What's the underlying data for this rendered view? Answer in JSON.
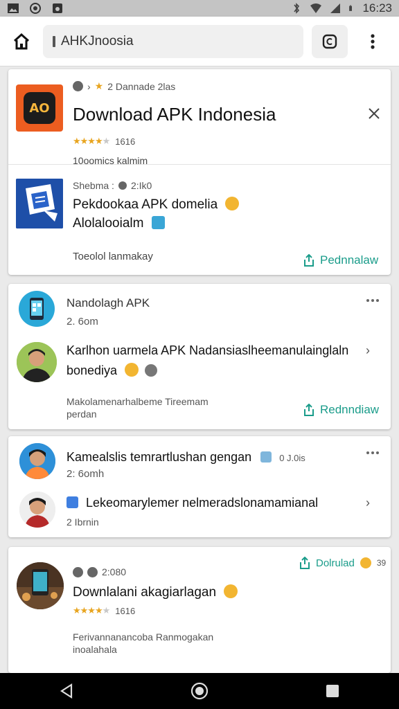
{
  "status_bar": {
    "time": "16:23"
  },
  "browser": {
    "url": "AHKJnoosia"
  },
  "card1": {
    "meta": "2 Dannade 2las",
    "title": "Download APK Indonesia",
    "rating_count": "1616",
    "subtitle": "10oomics kalmim",
    "app_icon_text": "AO",
    "post_meta": "Shebma : ",
    "post_time": "2:Ik0",
    "line1": "Pekdookaa APK domelia",
    "line2": "Alolalooialm",
    "footer": "Toeolol lanmakay",
    "action": "Pednnalaw"
  },
  "card2": {
    "title": "Nandolagh APK",
    "size": "2. 6om",
    "comment": "Karlhon uarmela APK Nadansiaslheemanulainglaln",
    "comment2": "bonediya",
    "footer1": "Makolamenarhalbeme Tireemam",
    "footer2": "perdan",
    "action": "Rednndiaw"
  },
  "card3": {
    "title": "Kamealslis temrartlushan gengan",
    "suffix": "0 J.0is",
    "size": "2: 6omh",
    "comment": "Lekeomarylemer nelmeradslonamamianal",
    "sub": "2 Ibrnin"
  },
  "card4": {
    "action": "Dolrulad",
    "badge": "39",
    "meta_time": "2:080",
    "title": "Downlalani akagiarlagan",
    "rating_count": "1616",
    "footer1": "Ferivannanancoba Ranmogakan",
    "footer2": "inoalahala"
  },
  "colors": {
    "accent": "#1a9c8a",
    "star": "#e8a520",
    "app_icon_bg": "#ec5d20"
  }
}
